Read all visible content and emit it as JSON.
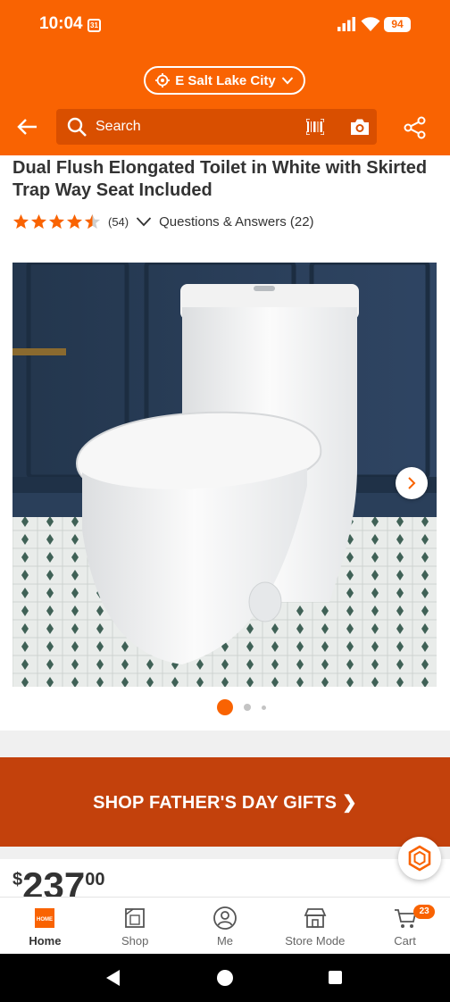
{
  "status_bar": {
    "time": "10:04",
    "calendar_day": "31",
    "battery": "94"
  },
  "header": {
    "location": "E Salt Lake City",
    "search_placeholder": "Search"
  },
  "product": {
    "title": "Dual Flush Elongated Toilet in White with Skirted Trap Way Seat Included",
    "rating": 4.5,
    "review_count": "(54)",
    "qa_label": "Questions & Answers (22)",
    "image_count": 3,
    "active_image": 1
  },
  "promo": {
    "label": "SHOP FATHER'S DAY GIFTS ❯"
  },
  "price": {
    "dollar_sign": "$",
    "whole": "237",
    "cents": "00"
  },
  "bottom_nav": {
    "items": [
      {
        "label": "Home",
        "icon": "home-depot-logo-icon"
      },
      {
        "label": "Shop",
        "icon": "shop-icon"
      },
      {
        "label": "Me",
        "icon": "person-icon"
      },
      {
        "label": "Store Mode",
        "icon": "store-icon"
      },
      {
        "label": "Cart",
        "icon": "cart-icon"
      }
    ],
    "cart_count": "23"
  },
  "colors": {
    "brand": "#f96302",
    "promo": "#c3410c"
  }
}
